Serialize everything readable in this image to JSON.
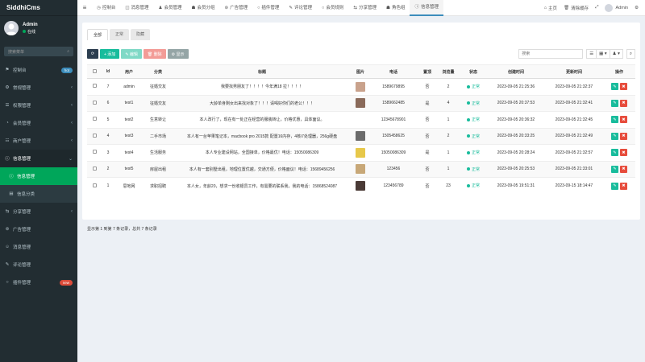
{
  "brand": "SiddhiCms",
  "user": {
    "name": "Admin",
    "status": "在线"
  },
  "sidebar": {
    "search_placeholder": "搜索菜单",
    "items": [
      {
        "icon": "⚑",
        "label": "控制台",
        "badge": "hot",
        "badge_color": "blue"
      },
      {
        "icon": "⚙",
        "label": "常规管理",
        "chevron": "‹"
      },
      {
        "icon": "☰",
        "label": "权限管理",
        "chevron": "‹"
      },
      {
        "icon": "◔",
        "label": "会员管理",
        "chevron": "‹"
      },
      {
        "icon": "☷",
        "label": "商户管理",
        "chevron": "‹"
      },
      {
        "icon": "ⓘ",
        "label": "信息管理",
        "chevron": "⌄"
      },
      {
        "icon": "ⓘ",
        "label": "信息管理"
      },
      {
        "icon": "▤",
        "label": "信息分类"
      },
      {
        "icon": "⇆",
        "label": "分享管理",
        "chevron": "‹"
      },
      {
        "icon": "⊚",
        "label": "广告管理"
      },
      {
        "icon": "☺",
        "label": "消息管理"
      },
      {
        "icon": "✎",
        "label": "评论管理"
      },
      {
        "icon": "○",
        "label": "插件管理",
        "badge": "new",
        "badge_color": "red"
      }
    ]
  },
  "topbar": {
    "toggle_icon": "≡",
    "tabs": [
      {
        "icon": "◷",
        "label": "控制台"
      },
      {
        "icon": "◫",
        "label": "消息管理"
      },
      {
        "icon": "♟",
        "label": "会员管理"
      },
      {
        "icon": "☗",
        "label": "会员分组"
      },
      {
        "icon": "⊚",
        "label": "广告管理"
      },
      {
        "icon": "○",
        "label": "插件管理"
      },
      {
        "icon": "✎",
        "label": "评论管理"
      },
      {
        "icon": "○",
        "label": "会员规则"
      },
      {
        "icon": "⇆",
        "label": "分享管理"
      },
      {
        "icon": "☗",
        "label": "角色组"
      },
      {
        "icon": "ⓘ",
        "label": "信息管理"
      }
    ],
    "right": {
      "home": "主页",
      "clear_cache": "清除缓存",
      "admin": "Admin"
    }
  },
  "filter_tabs": [
    "全部",
    "正常",
    "隐藏"
  ],
  "toolbar": {
    "refresh": "⟳",
    "add": "+ 添加",
    "edit": "✎ 编辑",
    "delete": "🗑 删除",
    "show": "⚙ 显示",
    "search_placeholder": "搜索"
  },
  "table": {
    "headers": [
      "",
      "Id",
      "用户",
      "分类",
      "标题",
      "图片",
      "电话",
      "置顶",
      "浏览量",
      "状态",
      "创建时间",
      "更新时间",
      "操作"
    ],
    "rows": [
      {
        "id": "7",
        "user": "admin",
        "category": "征婚交友",
        "title": "我要找男朋友了！！！！今年满18 拉！！！！",
        "image_color": "#c9a28c",
        "phone": "1589679895",
        "top": "否",
        "views": "2",
        "status": "正常",
        "created": "2023-09-05 21:25:36",
        "updated": "2023-09-05 21:32:37"
      },
      {
        "id": "6",
        "user": "test1",
        "category": "征婚交友",
        "title": "大龄单身剩女出来找对象了！！！请喝好你们的老公！！！",
        "image_color": "#8a6a5a",
        "phone": "1589662485",
        "top": "是",
        "views": "4",
        "status": "正常",
        "created": "2023-09-05 20:37:53",
        "updated": "2023-09-05 21:32:41"
      },
      {
        "id": "5",
        "user": "test2",
        "category": "生意转让",
        "title": "本人改行了，现在有一处正在经营的服装转让，价格优惠，具体面议。",
        "image_color": "",
        "phone": "12345678901",
        "top": "否",
        "views": "1",
        "status": "正常",
        "created": "2023-09-05 20:36:32",
        "updated": "2023-09-05 21:32:45"
      },
      {
        "id": "4",
        "user": "test3",
        "category": "二手市场",
        "title": "本人有一台苹果笔记本，macbook pro 2015款 配置16内存，4核i7处理器，256g硬盘",
        "image_color": "#6b6b6b",
        "phone": "1505458625",
        "top": "否",
        "views": "2",
        "status": "正常",
        "created": "2023-09-05 20:33:25",
        "updated": "2023-09-05 21:32:49"
      },
      {
        "id": "3",
        "user": "test4",
        "category": "生活服务",
        "title": "本人专业建设网站，全国接单，价格最优！电话：15050086309",
        "image_color": "#e7c84a",
        "phone": "15050086309",
        "top": "是",
        "views": "1",
        "status": "正常",
        "created": "2023-09-05 20:28:24",
        "updated": "2023-09-05 21:32:57"
      },
      {
        "id": "2",
        "user": "test5",
        "category": "房屋出租",
        "title": "本人有一套别墅出租，地理位置优越，交通方便，价格面议！电话：15689456256",
        "image_color": "#c8a878",
        "phone": "123456",
        "top": "否",
        "views": "1",
        "status": "正常",
        "created": "2023-09-05 20:25:53",
        "updated": "2023-09-05 21:33:01"
      },
      {
        "id": "1",
        "user": "思地网",
        "category": "求职招聘",
        "title": "本人女，年龄20，想求一份收银员工作，有需要的联系我，我的电话：15868524087",
        "image_color": "#4a3a36",
        "phone": "123456789",
        "top": "否",
        "views": "23",
        "status": "正常",
        "created": "2023-09-05 19:51:31",
        "updated": "2023-09-15 18:14:47"
      }
    ]
  },
  "footer_info": "显示第 1 到第 7 条记录，总共 7 条记录"
}
